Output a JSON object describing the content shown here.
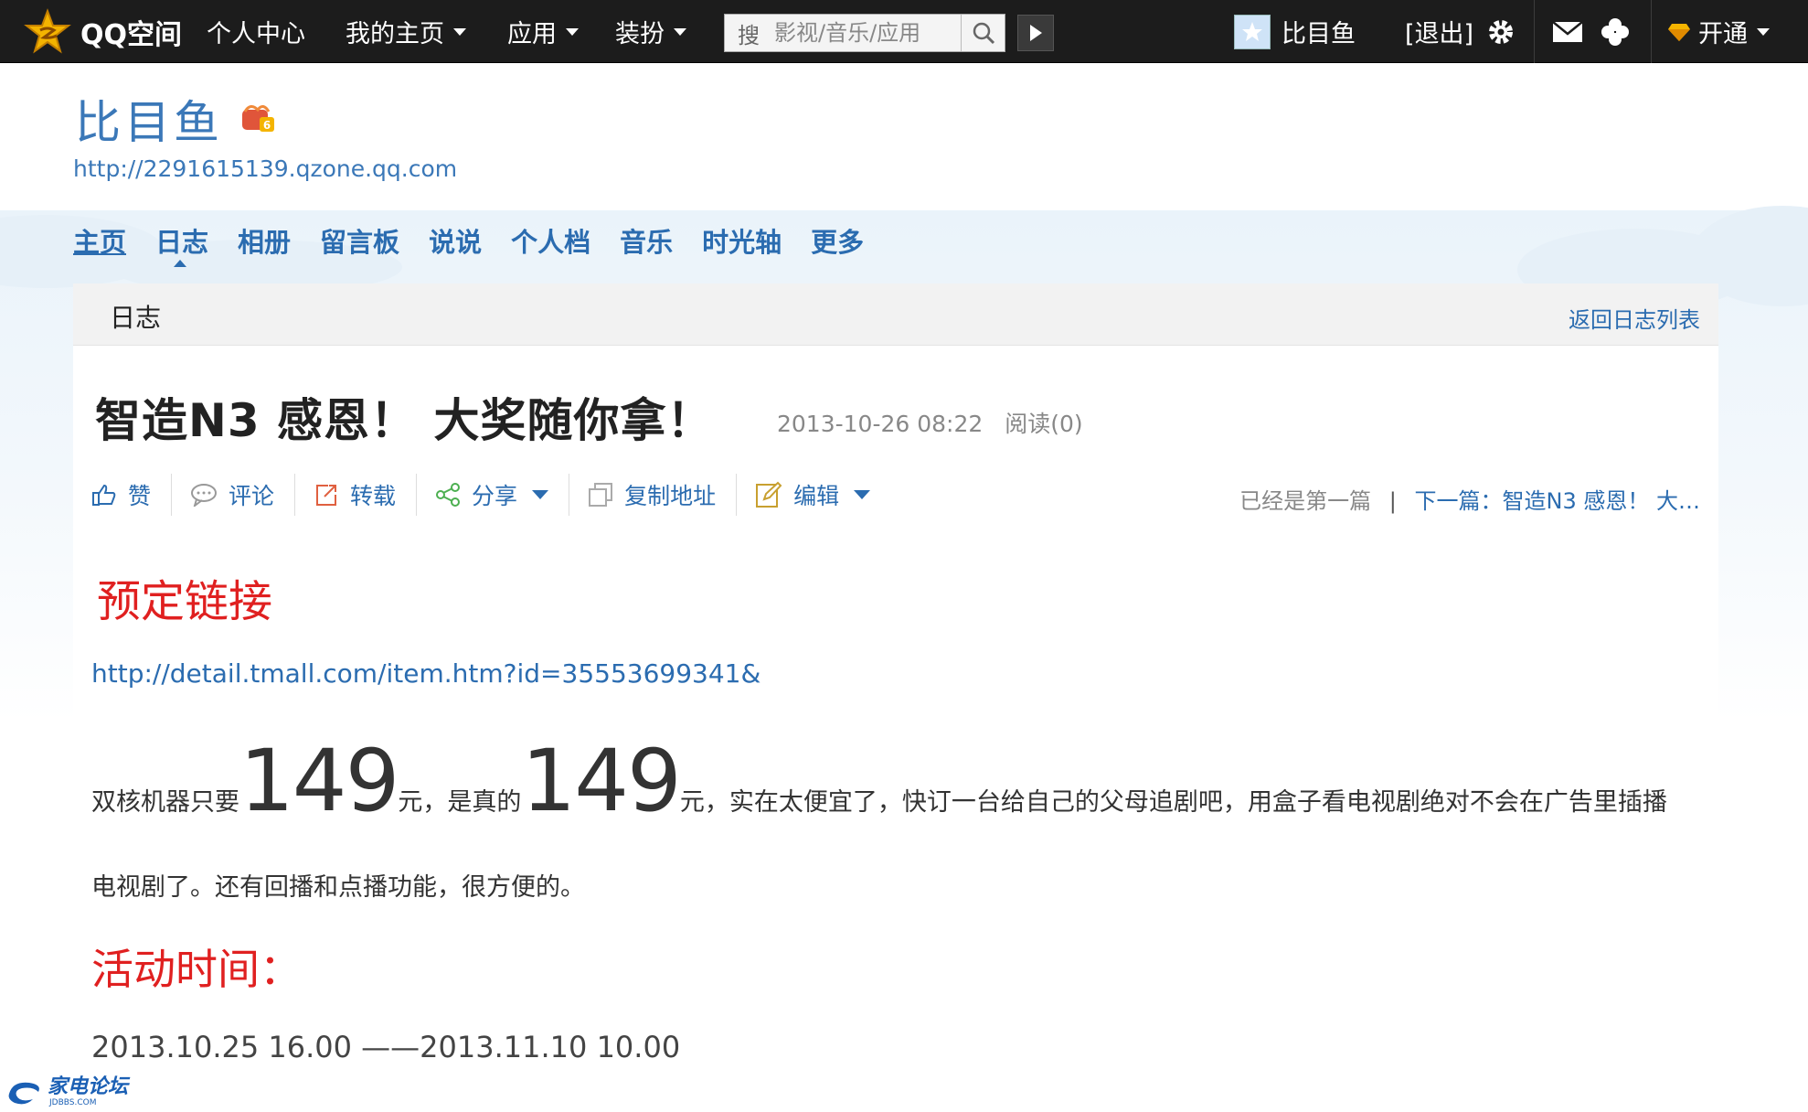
{
  "topbar": {
    "logo_text": "QQ空间",
    "nav": [
      "个人中心",
      "我的主页",
      "应用",
      "装扮"
    ],
    "search_label": "搜",
    "search_placeholder": "影视/音乐/应用",
    "username": "比目鱼",
    "logout": "[退出]",
    "open_label": "开通"
  },
  "profile": {
    "name": "比目鱼",
    "url": "http://2291615139.qzone.qq.com"
  },
  "nav": [
    "主页",
    "日志",
    "相册",
    "留言板",
    "说说",
    "个人档",
    "音乐",
    "时光轴",
    "更多"
  ],
  "card": {
    "section_title": "日志",
    "back_link": "返回日志列表"
  },
  "article": {
    "title": "智造N3 感恩！ 大奖随你拿！",
    "date": "2013-10-26 08:22",
    "reads": "阅读(0)",
    "toolbar": {
      "like": "赞",
      "comment": "评论",
      "repost": "转载",
      "share": "分享",
      "copy": "复制地址",
      "edit": "编辑"
    },
    "pager_first": "已经是第一篇",
    "pager_sep": "|",
    "pager_next": "下一篇：智造N3 感恩！ 大…",
    "heading1": "预定链接",
    "link": "http://detail.tmall.com/item.htm?id=35553699341&",
    "para_p1": "双核机器只要",
    "price1": "149",
    "para_p2": "元，是真的",
    "price2": "149",
    "para_p3": "元，实在太便宜了，快订一台给自己的父母追剧吧，用盒子看电视剧绝对不会在广告里插播",
    "para_line2": "电视剧了。还有回播和点播功能，很方便的。",
    "heading2": "活动时间：",
    "date_range": "2013.10.25 16.00 ——2013.11.10 10.00"
  },
  "watermark": {
    "text": "家电论坛",
    "sub": "JDBBS.COM"
  },
  "colors": {
    "topbar_bg": "#1c1c1c",
    "link_blue": "#2b6cb0",
    "heading_red": "#e02020"
  },
  "icons": [
    "qq-star-icon",
    "search-icon",
    "play-icon",
    "settings-icon",
    "mail-icon",
    "clover-icon",
    "diamond-icon",
    "gift-icon",
    "thumbs-up-icon",
    "comment-icon",
    "repost-icon",
    "share-icon",
    "copy-icon",
    "edit-icon"
  ]
}
